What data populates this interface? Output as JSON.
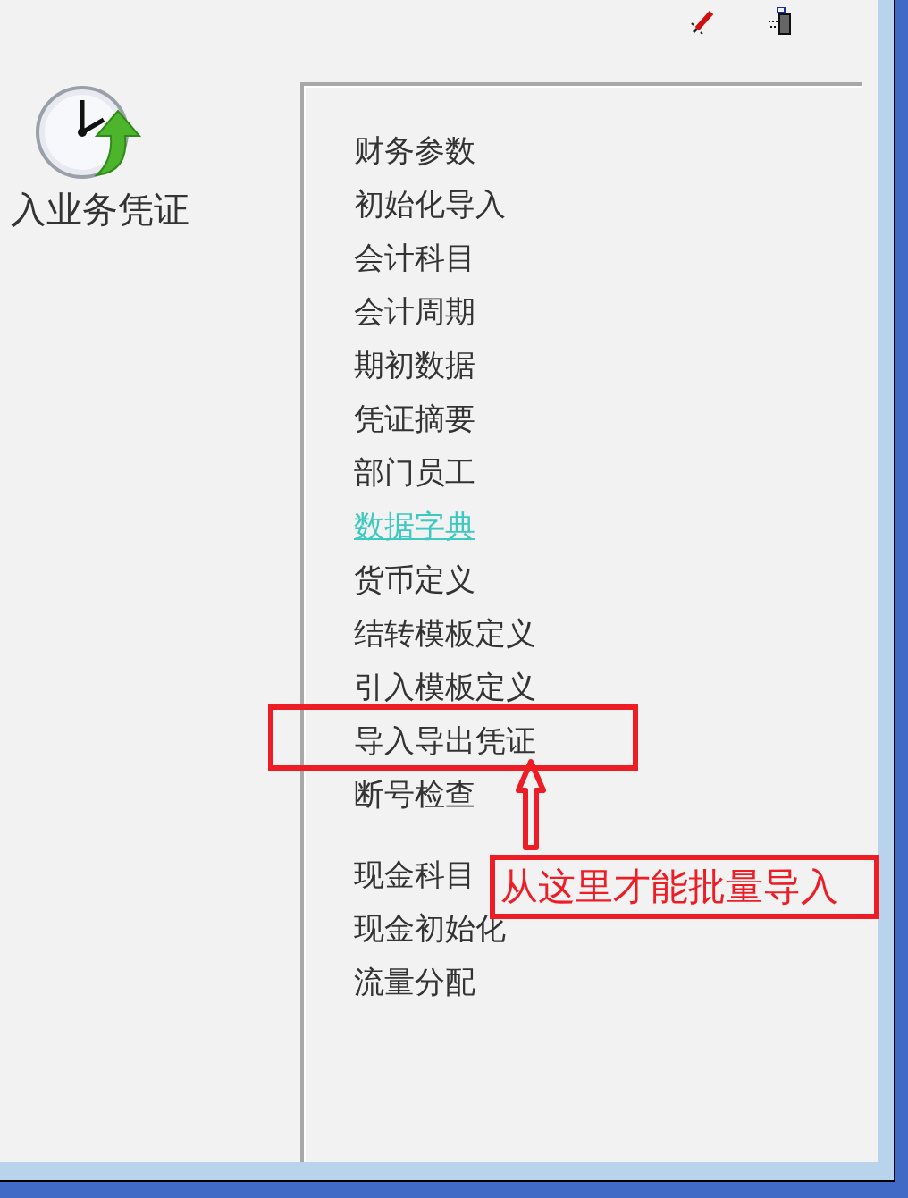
{
  "module": {
    "label": "入业务凭证"
  },
  "menu_groups": [
    [
      {
        "label": "财务参数",
        "kind": "plain"
      },
      {
        "label": "初始化导入",
        "kind": "plain"
      },
      {
        "label": "会计科目",
        "kind": "plain"
      },
      {
        "label": "会计周期",
        "kind": "plain"
      },
      {
        "label": "期初数据",
        "kind": "plain"
      },
      {
        "label": "凭证摘要",
        "kind": "plain"
      },
      {
        "label": "部门员工",
        "kind": "plain"
      },
      {
        "label": "数据字典",
        "kind": "link"
      },
      {
        "label": "货币定义",
        "kind": "plain"
      },
      {
        "label": "结转模板定义",
        "kind": "plain"
      },
      {
        "label": "引入模板定义",
        "kind": "plain"
      },
      {
        "label": "导入导出凭证",
        "kind": "plain"
      },
      {
        "label": "断号检查",
        "kind": "plain"
      }
    ],
    [
      {
        "label": "现金科目",
        "kind": "plain"
      },
      {
        "label": "现金初始化",
        "kind": "plain"
      },
      {
        "label": "流量分配",
        "kind": "plain"
      }
    ]
  ],
  "annotation": {
    "text": "从这里才能批量导入"
  }
}
